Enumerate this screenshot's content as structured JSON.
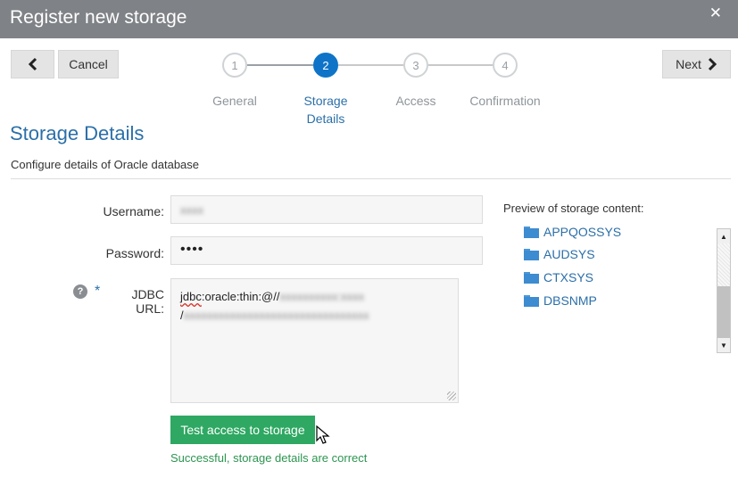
{
  "dialog": {
    "title": "Register new storage",
    "close_glyph": "✕"
  },
  "toolbar": {
    "back_icon": "chevron-left-icon",
    "cancel_label": "Cancel",
    "next_label": "Next",
    "next_icon": "chevron-right-icon"
  },
  "stepper": {
    "steps": [
      {
        "number": "1",
        "label": "General",
        "state": "done"
      },
      {
        "number": "2",
        "label": "Storage Details",
        "state": "active"
      },
      {
        "number": "3",
        "label": "Access",
        "state": "pending"
      },
      {
        "number": "4",
        "label": "Confirmation",
        "state": "pending"
      }
    ]
  },
  "page": {
    "title": "Storage Details",
    "subtitle": "Configure details of Oracle database"
  },
  "form": {
    "username_label": "Username:",
    "username_value": "xxxx",
    "password_label": "Password:",
    "password_value": "••••",
    "jdbc_label": "JDBC URL:",
    "jdbc_required_mark": "*",
    "jdbc_help_glyph": "?",
    "jdbc_line1_prefix": "jdbc",
    "jdbc_line1_mid": ":oracle:thin:@//",
    "jdbc_line1_blurred": "xxxxxxxxxx:xxxx",
    "jdbc_line2_prefix": "/",
    "jdbc_line2_blurred": "xxxxxxxxxxxxxxxxxxxxxxxxxxxxxxxx",
    "test_button_label": "Test access to storage",
    "status_message": "Successful, storage details are correct"
  },
  "preview": {
    "label": "Preview of storage content:",
    "items": [
      "APPQOSSYS",
      "AUDSYS",
      "CTXSYS",
      "DBSNMP"
    ]
  },
  "colors": {
    "accent": "#0f74c8",
    "link": "#2b6fa8",
    "success_button": "#2ea862",
    "success_text": "#2c9550",
    "titlebar": "#7f8286"
  }
}
